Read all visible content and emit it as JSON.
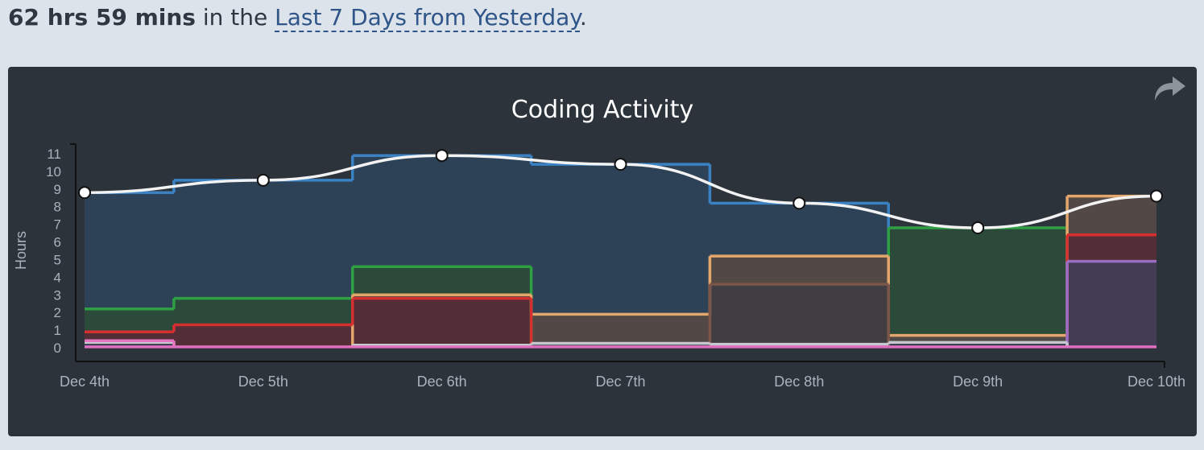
{
  "summary": {
    "total": "62 hrs 59 mins",
    "connector": " in the ",
    "range_label": "Last 7 Days from Yesterday",
    "end": "."
  },
  "share_icon": "share-arrow-icon",
  "chart_data": {
    "type": "area",
    "title": "Coding Activity",
    "ylabel": "Hours",
    "ylim": [
      0,
      11
    ],
    "yticks": [
      "0",
      "1",
      "2",
      "3",
      "4",
      "5",
      "6",
      "7",
      "8",
      "9",
      "10",
      "11"
    ],
    "categories": [
      "Dec 4th",
      "Dec 5th",
      "Dec 6th",
      "Dec 7th",
      "Dec 8th",
      "Dec 9th",
      "Dec 10th"
    ],
    "total_line": {
      "color": "#f2f2f2",
      "values": [
        8.8,
        9.5,
        10.9,
        10.4,
        8.2,
        6.8,
        8.6
      ]
    },
    "series": [
      {
        "color": "#3a82c4",
        "fill": "#2e4257",
        "values": [
          8.8,
          9.5,
          10.9,
          10.4,
          8.2,
          0.0,
          0.0
        ]
      },
      {
        "color": "#2ea043",
        "fill": "#2b4a3a",
        "values": [
          2.2,
          2.8,
          4.6,
          0.0,
          0.0,
          6.8,
          0.0
        ]
      },
      {
        "color": "#e3a66b",
        "fill": "#524845",
        "values": [
          0.0,
          0.0,
          3.0,
          1.9,
          5.2,
          0.7,
          8.6
        ]
      },
      {
        "color": "#d62f2f",
        "fill": "#542e37",
        "values": [
          0.9,
          1.3,
          2.8,
          0.0,
          0.0,
          0.0,
          6.4
        ]
      },
      {
        "color": "#7a5548",
        "fill": "#413e43",
        "values": [
          0.0,
          0.0,
          0.0,
          0.0,
          3.6,
          0.0,
          0.0
        ]
      },
      {
        "color": "#9a6cc4",
        "fill": "#443b55",
        "values": [
          0.0,
          0.0,
          0.0,
          0.0,
          0.0,
          0.0,
          4.9
        ]
      },
      {
        "color": "#c6c7cf",
        "fill": "#33394a",
        "values": [
          0.3,
          0.0,
          0.15,
          0.25,
          0.2,
          0.3,
          0.0
        ]
      },
      {
        "color": "#e577c2",
        "fill": "#3b3850",
        "values": [
          0.4,
          0.0,
          0.0,
          0.0,
          0.0,
          0.0,
          0.0
        ]
      },
      {
        "color": "#e06fc1",
        "fill": "none",
        "values": [
          0.05,
          0.05,
          0.05,
          0.05,
          0.05,
          0.05,
          0.05
        ]
      }
    ],
    "grid": false,
    "legend": "none"
  }
}
